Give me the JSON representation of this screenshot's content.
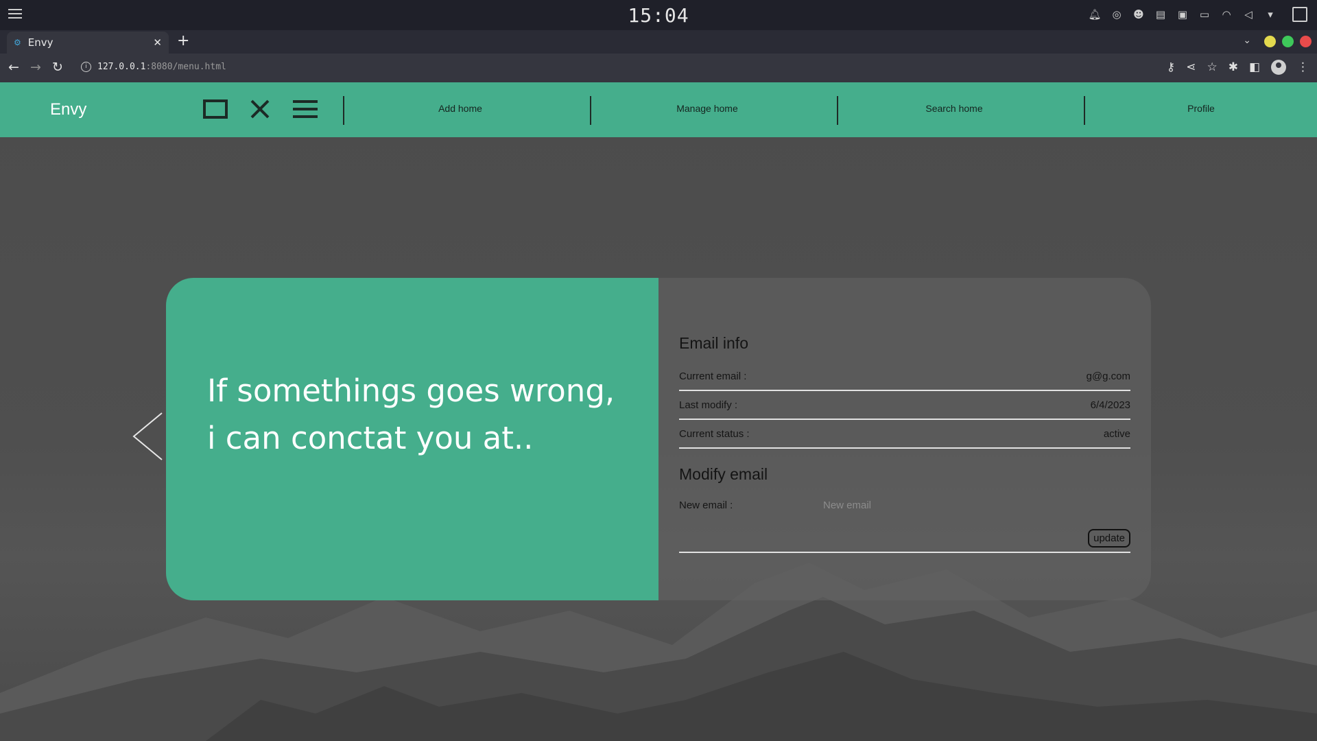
{
  "os": {
    "clock": "15:04",
    "tray_icons": [
      "bell-icon",
      "steam-icon",
      "discord-icon",
      "clipboard-icon",
      "package-icon",
      "battery-icon",
      "wifi-icon",
      "speaker-muted-icon",
      "dropdown-icon"
    ]
  },
  "browser": {
    "tab_title": "Envy",
    "url_host": "127.0.0.1",
    "url_rest": ":8080/menu.html",
    "traffic_colors": [
      "#e3d94e",
      "#3ec85a",
      "#e94b4b"
    ]
  },
  "navbar": {
    "brand": "Envy",
    "links": [
      "Add home",
      "Manage home",
      "Search home",
      "Profile"
    ],
    "bg_color": "#45ae8c"
  },
  "card": {
    "hero_text": "If somethings goes wrong, i can conctat you at..",
    "email_info": {
      "title": "Email info",
      "rows": [
        {
          "label": "Current email :",
          "value": "g@g.com"
        },
        {
          "label": "Last modify :",
          "value": "6/4/2023"
        },
        {
          "label": "Current status :",
          "value": "active"
        }
      ]
    },
    "modify": {
      "title": "Modify email",
      "new_email_label": "New email :",
      "new_email_placeholder": "New email",
      "new_email_value": "",
      "update_label": "update"
    }
  }
}
